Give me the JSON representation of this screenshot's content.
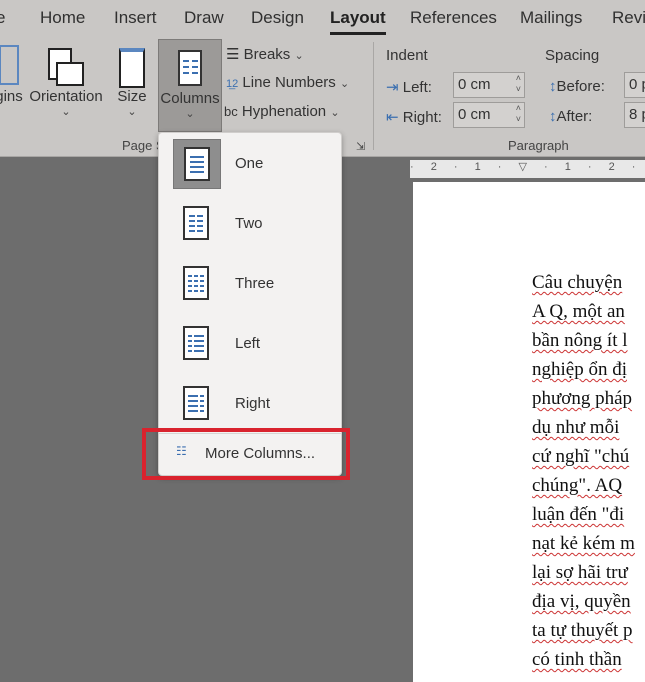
{
  "tabs": [
    "e",
    "Home",
    "Insert",
    "Draw",
    "Design",
    "Layout",
    "References",
    "Mailings",
    "Revie"
  ],
  "active_tab": "Layout",
  "ribbon": {
    "margins": "gins",
    "orientation": "Orientation",
    "size": "Size",
    "columns": "Columns",
    "breaks": "Breaks",
    "line_numbers": "Line Numbers",
    "hyphenation": "Hyphenation",
    "page_setup_group": "Page S",
    "indent_label": "Indent",
    "spacing_label": "Spacing",
    "left_label": "Left:",
    "left_value": "0 cm",
    "right_label": "Right:",
    "right_value": "0 cm",
    "before_label": "Before:",
    "before_value": "0 p",
    "after_label": "After:",
    "after_value": "8 p",
    "paragraph_group": "Paragraph"
  },
  "ruler": "· 2 · 1 · ▽ · 1 · 2 ·",
  "columns_menu": {
    "items": [
      {
        "label": "One",
        "selected": true
      },
      {
        "label": "Two"
      },
      {
        "label": "Three"
      },
      {
        "label": "Left"
      },
      {
        "label": "Right"
      }
    ],
    "more": "More Columns..."
  },
  "highlight_color": "#d9232e",
  "document_lines": [
    "Câu chuyện",
    "A Q, một an",
    "bần nông ít l",
    "nghiệp ổn đị",
    "phương pháp",
    "dụ như mỗi",
    "cứ nghĩ \"chú",
    "chúng\". AQ",
    "luận đến \"đi",
    "nạt kẻ kém m",
    "lại sợ hãi trư",
    "địa vị, quyền",
    "ta tự thuyết p",
    "có tinh thần"
  ]
}
